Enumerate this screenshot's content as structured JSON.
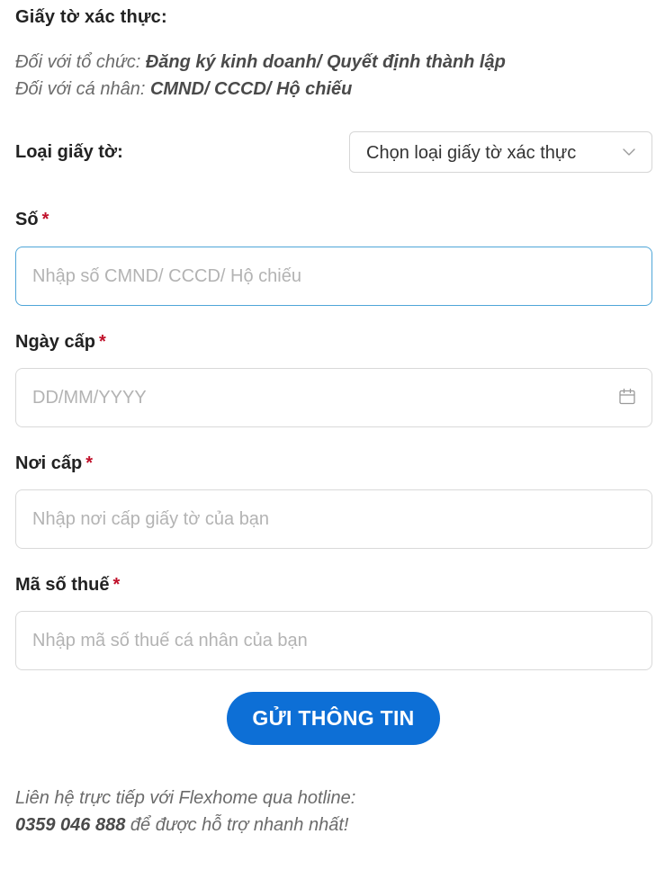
{
  "section": {
    "title": "Giấy tờ xác thực:"
  },
  "notes": {
    "org_prefix": "Đối với tổ chức:",
    "org_docs": "Đăng ký kinh doanh/ Quyết định thành lập",
    "person_prefix": "Đối với cá nhân:",
    "person_docs": "CMND/ CCCD/ Hộ chiếu"
  },
  "doc_type": {
    "label": "Loại giấy tờ:",
    "selected": "Chọn loại giấy tờ xác thực",
    "icon": "chevron-down-icon"
  },
  "fields": {
    "number": {
      "label": "Số",
      "required_mark": "*",
      "value": "",
      "placeholder": "Nhập số CMND/ CCCD/ Hộ chiếu"
    },
    "issue_date": {
      "label": "Ngày cấp",
      "required_mark": "*",
      "value": "",
      "placeholder": "DD/MM/YYYY",
      "icon": "calendar-icon"
    },
    "issue_place": {
      "label": "Nơi cấp",
      "required_mark": "*",
      "value": "",
      "placeholder": "Nhập nơi cấp giấy tờ của bạn"
    },
    "tax_code": {
      "label": "Mã số thuế",
      "required_mark": "*",
      "value": "",
      "placeholder": "Nhập mã số thuế cá nhân của bạn"
    }
  },
  "submit": {
    "label": "GỬI THÔNG TIN"
  },
  "contact": {
    "line1": "Liên hệ trực tiếp với Flexhome qua hotline:",
    "hotline": "0359 046 888",
    "line2_suffix": " để được hỗ trợ nhanh nhất!"
  },
  "colors": {
    "primary": "#0d6fd6",
    "required": "#c0102a",
    "focus_border": "#4fa6d8",
    "border": "#d9d9d9",
    "placeholder": "#b3b3b3"
  }
}
